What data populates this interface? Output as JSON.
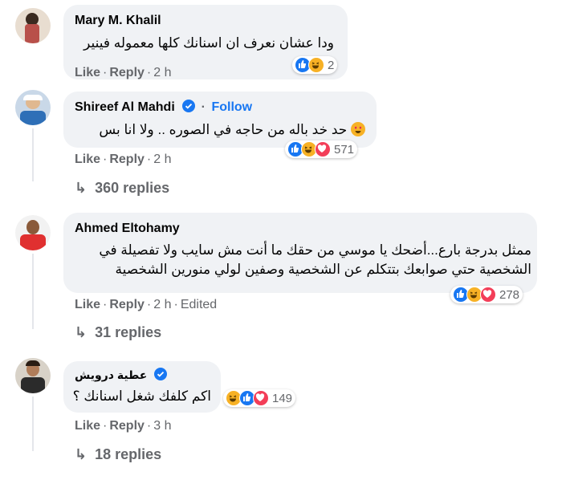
{
  "comments": [
    {
      "author": "Mary M. Khalil",
      "text": "ودا عشان نعرف ان اسنانك كلها معموله فينير",
      "reaction_count": "2",
      "actions": {
        "like": "Like",
        "reply": "Reply",
        "time": "2 h"
      }
    },
    {
      "author": "Shireef Al Mahdi",
      "follow": "Follow",
      "text": "حد خد باله من حاجه في الصوره .. ولا انا بس",
      "reaction_count": "571",
      "actions": {
        "like": "Like",
        "reply": "Reply",
        "time": "2 h"
      },
      "replies": "360 replies"
    },
    {
      "author": "Ahmed Eltohamy",
      "text_lines": [
        "ممثل بدرجة بارع...أضحك يا موسي من حقك ما أنت مش سايب ولا تفصيلة في",
        "الشخصية حتي صوابعك بتتكلم عن الشخصية وصفين لولي منورين الشخصية"
      ],
      "reaction_count": "278",
      "actions": {
        "like": "Like",
        "reply": "Reply",
        "time": "2 h",
        "edited": "Edited"
      },
      "replies": "31 replies"
    },
    {
      "author": "عطية درويش",
      "text": "اكم كلفك شغل اسنانك ؟",
      "reaction_count": "149",
      "actions": {
        "like": "Like",
        "reply": "Reply",
        "time": "3 h"
      },
      "replies": "18 replies"
    }
  ],
  "colors": {
    "bubble": "#f0f2f5",
    "secondary_text": "#65676b",
    "link_blue": "#1877f2"
  }
}
